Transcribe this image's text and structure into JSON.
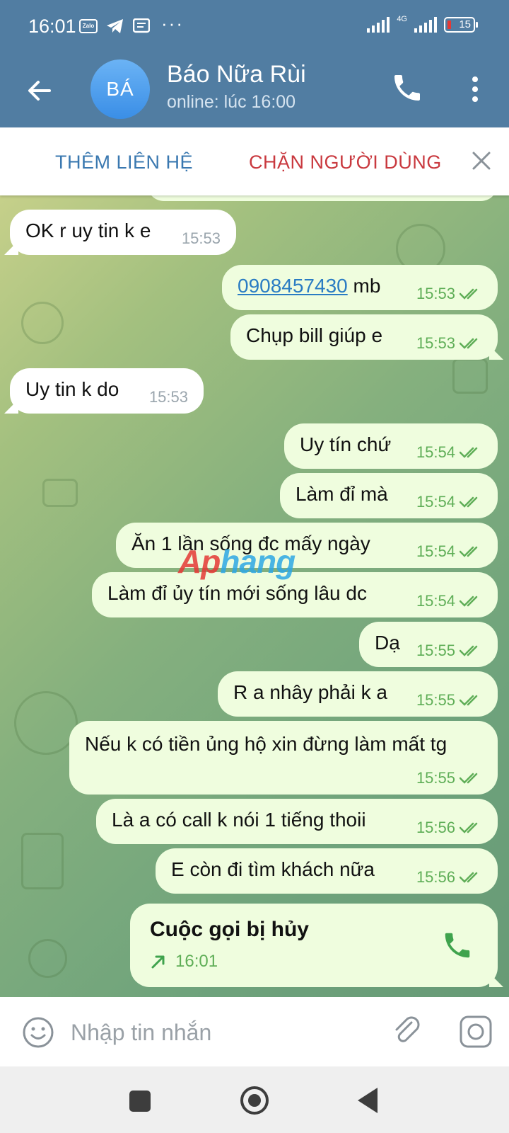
{
  "status_bar": {
    "time": "16:01",
    "app_icons": [
      "zalo-icon",
      "telegram-icon",
      "message-icon"
    ],
    "zalo_label": "Zalo",
    "more": "···",
    "network": "4G",
    "battery": "15"
  },
  "header": {
    "avatar_initials": "BÁ",
    "title": "Báo Nữa Rùi",
    "status": "online: lúc 16:00"
  },
  "action_bar": {
    "add_contact": "THÊM LIÊN HỆ",
    "block_user": "CHẶN NGƯỜI DÙNG"
  },
  "messages": [
    {
      "dir": "in",
      "text": "OK r uy tin k e",
      "time": "15:53"
    },
    {
      "dir": "out",
      "link": "0908457430",
      "text": " mb",
      "time": "15:53"
    },
    {
      "dir": "out",
      "text": "Chụp bill giúp e",
      "time": "15:53"
    },
    {
      "dir": "in",
      "text": "Uy tin k do",
      "time": "15:53"
    },
    {
      "dir": "out",
      "text": "Uy tín chứ",
      "time": "15:54"
    },
    {
      "dir": "out",
      "text": "Làm đỉ mà",
      "time": "15:54"
    },
    {
      "dir": "out",
      "text": "Ăn 1 lần sống đc mấy ngày",
      "time": "15:54"
    },
    {
      "dir": "out",
      "text": "Làm đỉ ủy tín mới sống lâu dc",
      "time": "15:54"
    },
    {
      "dir": "out",
      "text": "Dạ",
      "time": "15:55"
    },
    {
      "dir": "out",
      "text": "R a nhây phải k a",
      "time": "15:55"
    },
    {
      "dir": "out",
      "text": "Nếu k có tiền ủng hộ xin đừng làm mất tg",
      "time": "15:55"
    },
    {
      "dir": "out",
      "text": "Là a có call k nói 1 tiếng thoii",
      "time": "15:56"
    },
    {
      "dir": "out",
      "text": "E còn đi tìm khách nữa",
      "time": "15:56"
    }
  ],
  "call_card": {
    "title": "Cuộc gọi bị hủy",
    "time": "16:01"
  },
  "watermark": {
    "part1": "Ap",
    "part2": "hang"
  },
  "input": {
    "placeholder": "Nhập tin nhắn"
  },
  "colors": {
    "header": "#517da2",
    "outgoing_bubble": "#effdde",
    "incoming_bubble": "#ffffff",
    "read_ticks": "#5fae57",
    "link": "#2a7cc3",
    "block_red": "#c9393f",
    "add_blue": "#3a78b0"
  }
}
